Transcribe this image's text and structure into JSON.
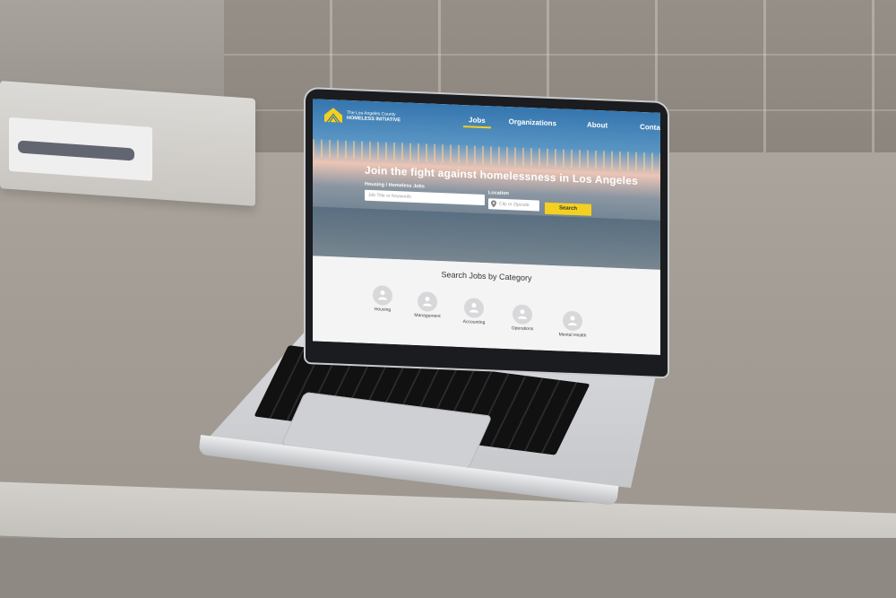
{
  "site": {
    "logo": {
      "line1": "The Los Angeles County",
      "line2": "HOMELESS INITIATIVE"
    },
    "nav": [
      {
        "label": "Jobs",
        "active": true
      },
      {
        "label": "Organizations",
        "active": false
      },
      {
        "label": "About",
        "active": false
      },
      {
        "label": "Contact",
        "active": false
      }
    ],
    "hero": {
      "headline": "Join the fight against homelessness in Los Angeles",
      "jobs_label": "Housing / Homeless Jobs",
      "jobs_placeholder": "Job Title or Keywords",
      "location_label": "Location",
      "location_placeholder": "City or Zipcode",
      "search_button": "Search"
    },
    "categories": {
      "title": "Search Jobs by Category",
      "items": [
        {
          "label": "Housing"
        },
        {
          "label": "Management"
        },
        {
          "label": "Accounting"
        },
        {
          "label": "Operations"
        },
        {
          "label": "Mental Health"
        }
      ]
    },
    "colors": {
      "nav_bar": "#2a6eaa",
      "accent": "#f4d020",
      "category_bg": "#f4f4f5"
    }
  }
}
